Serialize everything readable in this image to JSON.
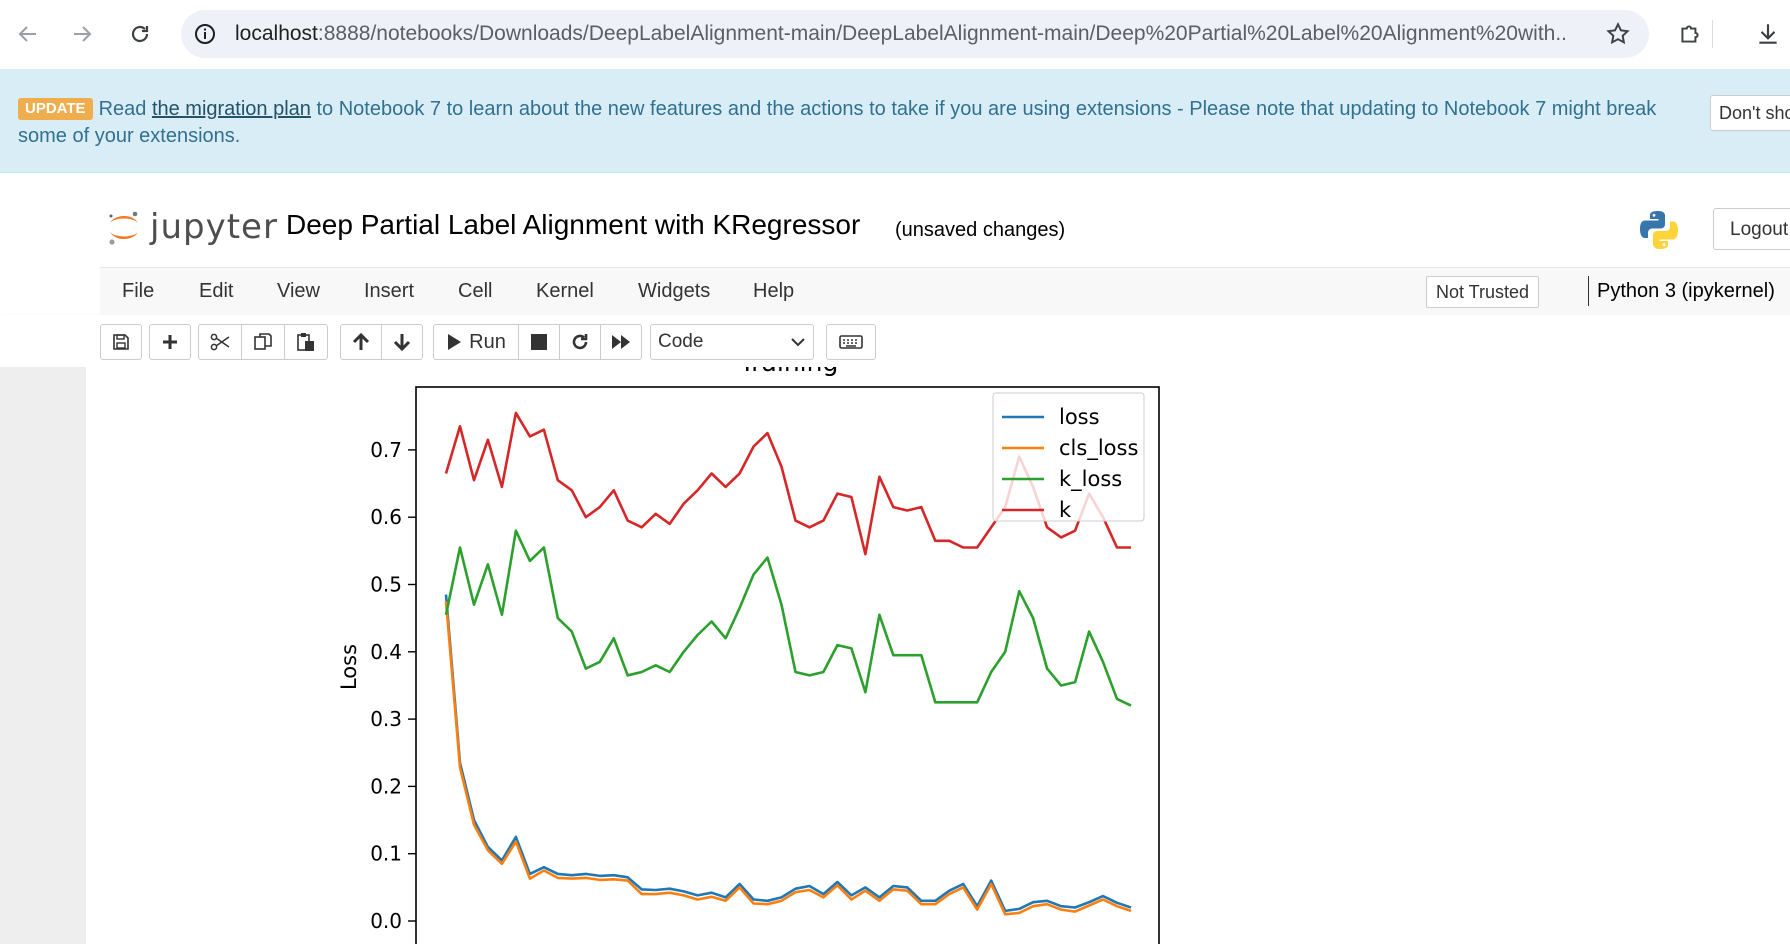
{
  "browser": {
    "url_host": "localhost",
    "url_path": ":8888/notebooks/Downloads/DeepLabelAlignment-main/DeepLabelAlignment-main/Deep%20Partial%20Label%20Alignment%20with..."
  },
  "banner": {
    "badge": "UPDATE",
    "text_before": "Read ",
    "link": "the migration plan",
    "text_after": " to Notebook 7 to learn about the new features and the actions to take if you are using extensions - Please note that updating to Notebook 7 might break some of your extensions.",
    "dont_show": "Don't show"
  },
  "header": {
    "logo_text": "jupyter",
    "notebook_title": "Deep Partial Label Alignment with KRegressor",
    "save_status": "(unsaved changes)",
    "logout": "Logout"
  },
  "menubar": {
    "items": [
      "File",
      "Edit",
      "View",
      "Insert",
      "Cell",
      "Kernel",
      "Widgets",
      "Help"
    ],
    "trust": "Not Trusted",
    "kernel": "Python 3 (ipykernel)"
  },
  "toolbar": {
    "run_label": "Run",
    "cell_type": "Code"
  },
  "chart_data": {
    "type": "line",
    "title": "Training",
    "ylabel": "Loss",
    "ylim": [
      0.0,
      0.8
    ],
    "yticks": [
      "0.0",
      "0.1",
      "0.2",
      "0.3",
      "0.4",
      "0.5",
      "0.6",
      "0.7"
    ],
    "legend_position": "top-right",
    "series": [
      {
        "name": "loss",
        "color": "#1f77b4",
        "values": [
          0.485,
          0.235,
          0.15,
          0.11,
          0.09,
          0.125,
          0.07,
          0.08,
          0.07,
          0.068,
          0.07,
          0.067,
          0.068,
          0.065,
          0.047,
          0.046,
          0.048,
          0.044,
          0.038,
          0.042,
          0.035,
          0.055,
          0.032,
          0.03,
          0.035,
          0.048,
          0.052,
          0.04,
          0.058,
          0.038,
          0.05,
          0.035,
          0.052,
          0.05,
          0.03,
          0.03,
          0.045,
          0.055,
          0.022,
          0.06,
          0.015,
          0.018,
          0.028,
          0.03,
          0.022,
          0.02,
          0.028,
          0.037,
          0.027,
          0.02
        ]
      },
      {
        "name": "cls_loss",
        "color": "#ff7f0e",
        "values": [
          0.475,
          0.228,
          0.143,
          0.105,
          0.085,
          0.118,
          0.063,
          0.075,
          0.064,
          0.063,
          0.064,
          0.061,
          0.062,
          0.06,
          0.04,
          0.04,
          0.042,
          0.038,
          0.032,
          0.036,
          0.03,
          0.05,
          0.026,
          0.025,
          0.03,
          0.043,
          0.046,
          0.035,
          0.053,
          0.032,
          0.045,
          0.03,
          0.047,
          0.045,
          0.025,
          0.025,
          0.04,
          0.05,
          0.017,
          0.055,
          0.01,
          0.012,
          0.022,
          0.025,
          0.017,
          0.014,
          0.023,
          0.032,
          0.022,
          0.015
        ]
      },
      {
        "name": "k_loss",
        "color": "#2ca02c",
        "values": [
          0.455,
          0.555,
          0.47,
          0.53,
          0.455,
          0.58,
          0.535,
          0.555,
          0.45,
          0.43,
          0.375,
          0.385,
          0.42,
          0.365,
          0.37,
          0.38,
          0.37,
          0.4,
          0.425,
          0.445,
          0.42,
          0.465,
          0.515,
          0.54,
          0.47,
          0.37,
          0.365,
          0.37,
          0.41,
          0.405,
          0.34,
          0.455,
          0.395,
          0.395,
          0.395,
          0.325,
          0.325,
          0.325,
          0.325,
          0.37,
          0.4,
          0.49,
          0.45,
          0.375,
          0.35,
          0.355,
          0.43,
          0.385,
          0.33,
          0.32
        ]
      },
      {
        "name": "k",
        "color": "#d62728",
        "values": [
          0.665,
          0.735,
          0.655,
          0.715,
          0.645,
          0.755,
          0.72,
          0.73,
          0.655,
          0.64,
          0.6,
          0.615,
          0.64,
          0.595,
          0.585,
          0.605,
          0.59,
          0.62,
          0.64,
          0.665,
          0.645,
          0.665,
          0.705,
          0.725,
          0.675,
          0.595,
          0.585,
          0.595,
          0.635,
          0.63,
          0.545,
          0.66,
          0.615,
          0.61,
          0.615,
          0.565,
          0.565,
          0.555,
          0.555,
          0.585,
          0.615,
          0.69,
          0.645,
          0.585,
          0.57,
          0.58,
          0.635,
          0.6,
          0.555,
          0.555
        ]
      }
    ]
  }
}
